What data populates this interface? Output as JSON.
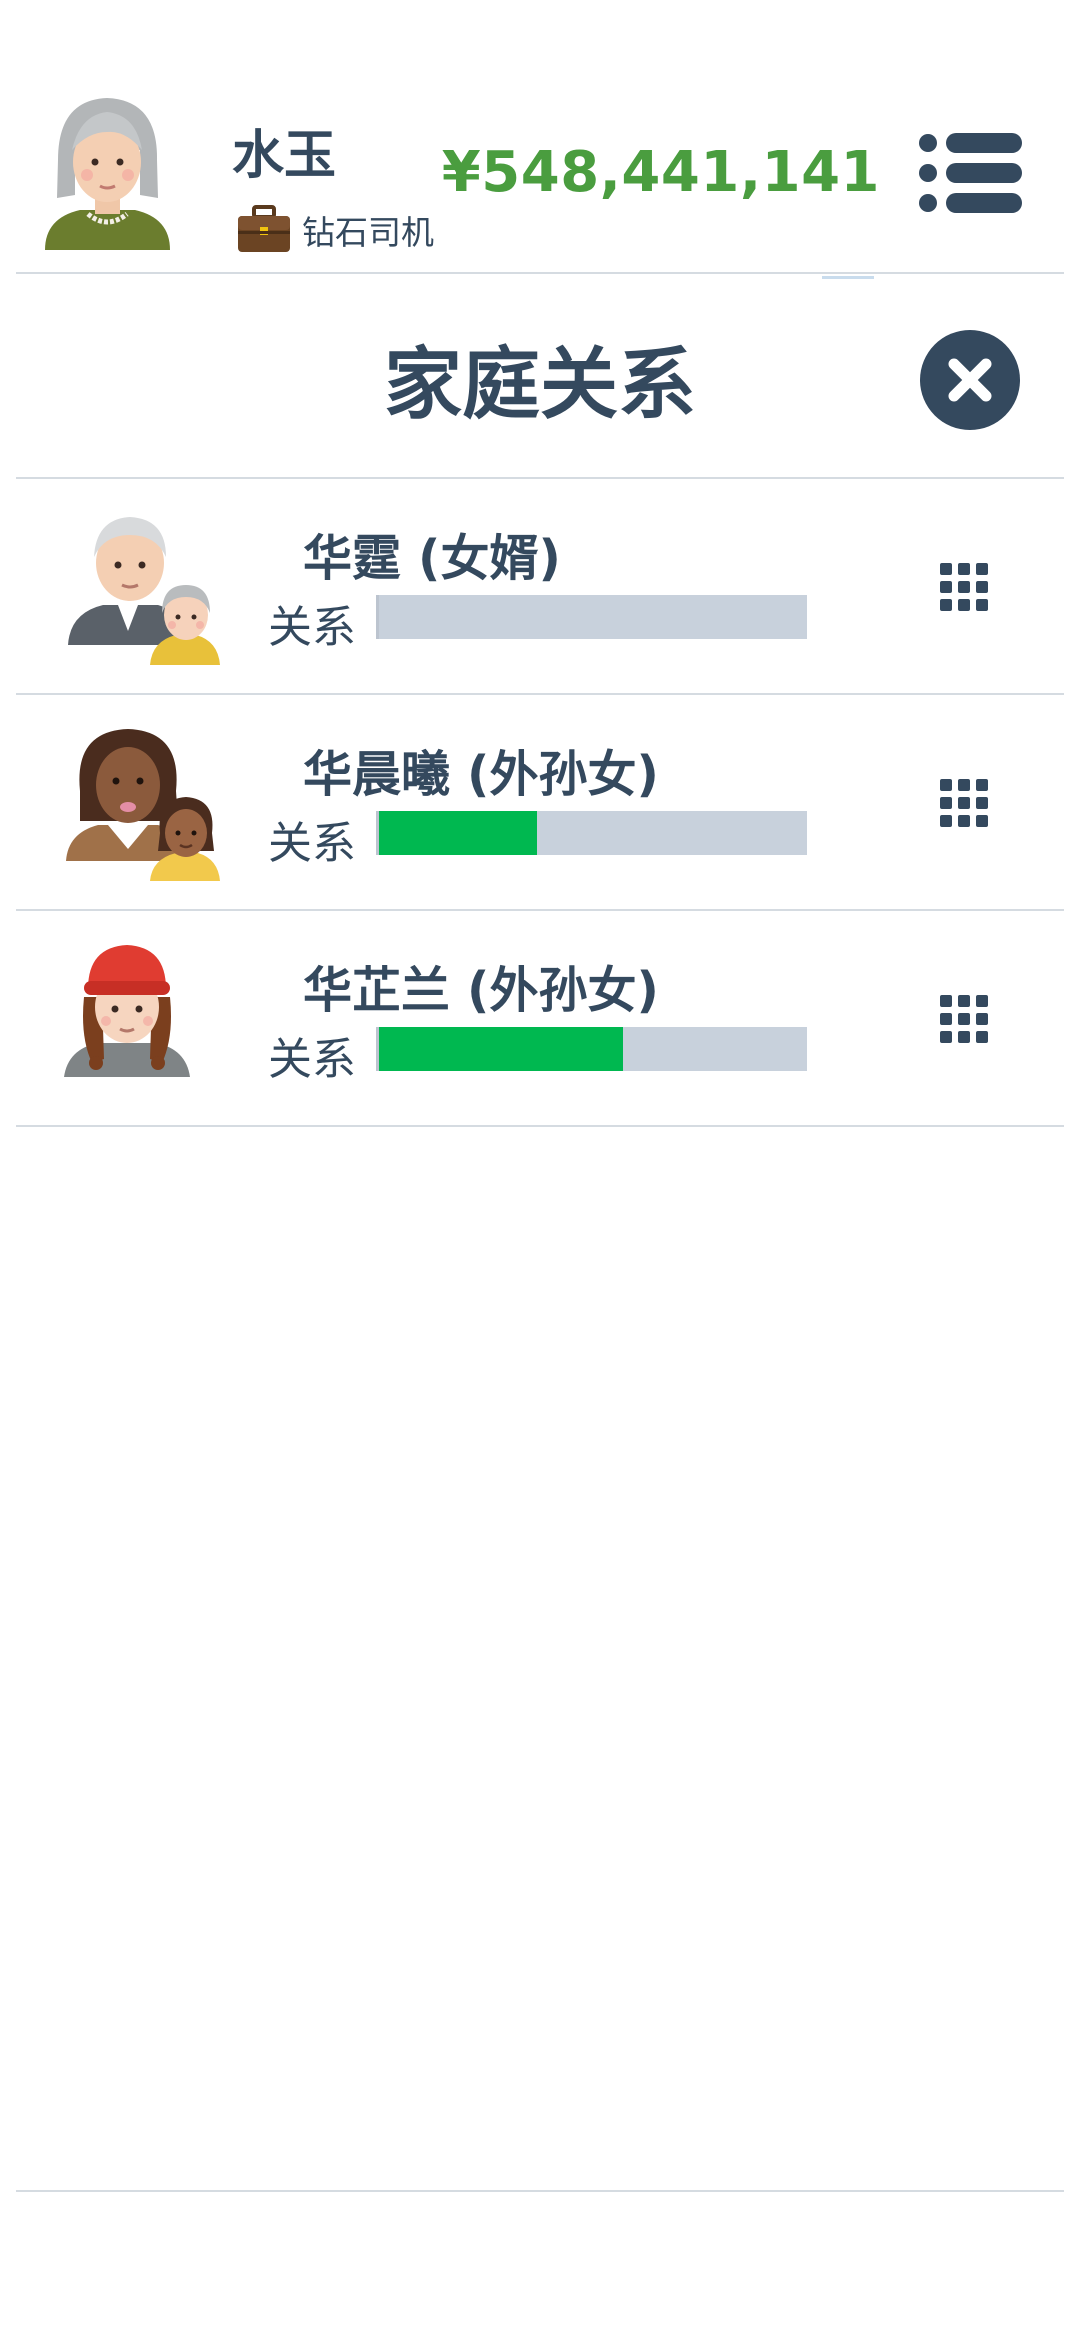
{
  "player": {
    "name": "水玉",
    "job": "钻石司机",
    "money": "¥548,441,141",
    "money_color": "#4a9d3f",
    "avatar": "elderly-woman-avatar",
    "job_icon": "briefcase-icon"
  },
  "panel": {
    "title": "家庭关系",
    "close_icon": "close-icon"
  },
  "relationships": [
    {
      "name": "华霆 (女婿)",
      "label": "关系",
      "level": 0.0,
      "avatar": "elderly-man-with-grandma-avatar"
    },
    {
      "name": "华晨曦 (外孙女)",
      "label": "关系",
      "level": 0.37,
      "avatar": "woman-with-child-avatar"
    },
    {
      "name": "华芷兰 (外孙女)",
      "label": "关系",
      "level": 0.57,
      "avatar": "girl-red-hat-avatar"
    }
  ],
  "colors": {
    "text": "#34495e",
    "bar_track": "#c8d1dc",
    "bar_fill": "#00b850",
    "button_dark": "#34495e"
  }
}
